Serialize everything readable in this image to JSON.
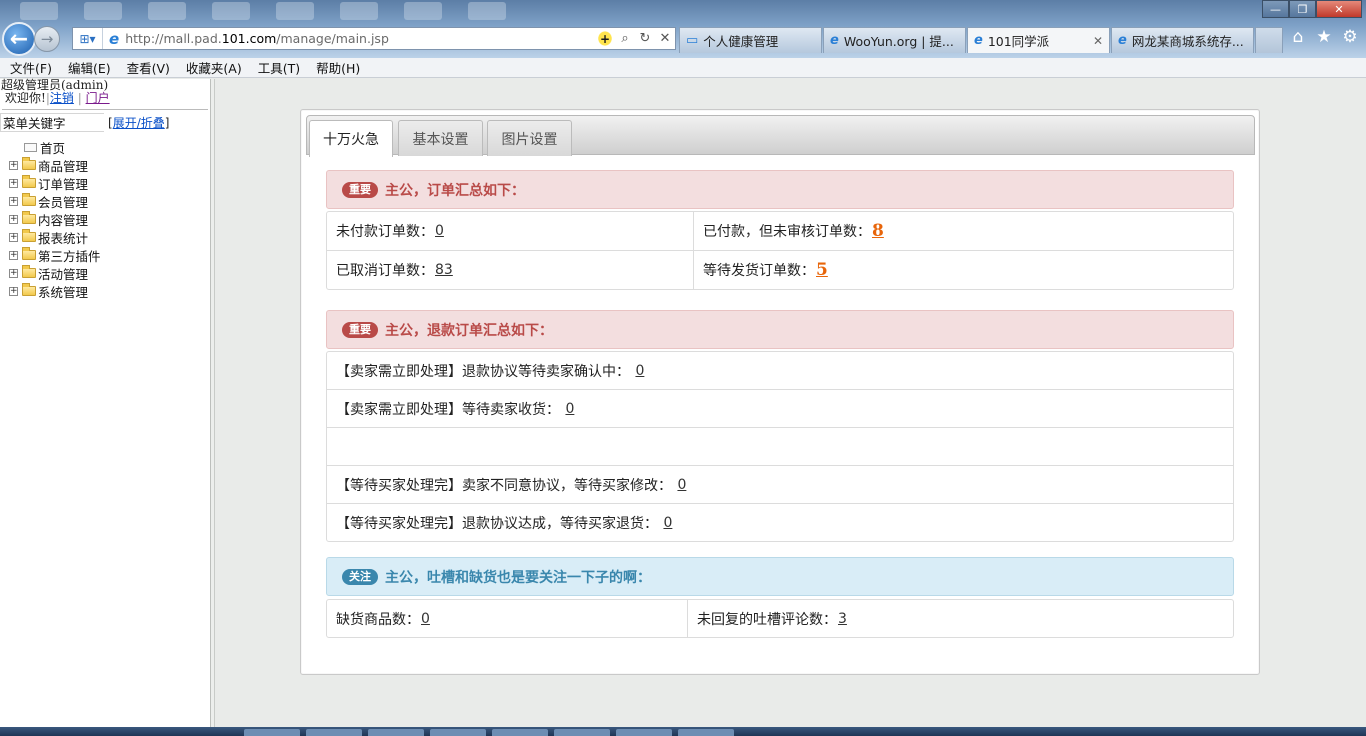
{
  "browser": {
    "url_prefix": "http://mall.pad.",
    "url_host": "101.com",
    "url_path": "/manage/main.jsp",
    "tabs": [
      {
        "label": "个人健康管理",
        "active": false
      },
      {
        "label": "WooYun.org | 提...",
        "active": false
      },
      {
        "label": "101同学派",
        "active": true
      },
      {
        "label": "网龙某商城系统存...",
        "active": false
      }
    ],
    "menu": [
      "文件(F)",
      "编辑(E)",
      "查看(V)",
      "收藏夹(A)",
      "工具(T)",
      "帮助(H)"
    ]
  },
  "sidebar": {
    "admin": "超级管理员(admin)",
    "welcome": "欢迎你!",
    "logout": "注销",
    "sep": "|",
    "portal": "门户",
    "search_value": "菜单关键字",
    "toggle_open": "[",
    "toggle_link": "展开/折叠",
    "toggle_close": "]",
    "home": "首页",
    "items": [
      "商品管理",
      "订单管理",
      "会员管理",
      "内容管理",
      "报表统计",
      "第三方插件",
      "活动管理",
      "系统管理"
    ]
  },
  "panel": {
    "tabs": [
      "十万火急",
      "基本设置",
      "图片设置"
    ],
    "orders": {
      "badge": "重要",
      "title": "主公，订单汇总如下：",
      "unpaid_label": "未付款订单数：",
      "unpaid_value": "0",
      "paid_unreviewed_label": "已付款，但未审核订单数：",
      "paid_unreviewed_value": "8",
      "cancelled_label": "已取消订单数：",
      "cancelled_value": "83",
      "awaiting_ship_label": "等待发货订单数：",
      "awaiting_ship_value": "5"
    },
    "refunds": {
      "badge": "重要",
      "title": "主公，退款订单汇总如下：",
      "row1_label": "【卖家需立即处理】退款协议等待卖家确认中：",
      "row1_value": "0",
      "row2_label": "【卖家需立即处理】等待卖家收货：",
      "row2_value": "0",
      "row4_label": "【等待买家处理完】卖家不同意协议，等待买家修改：",
      "row4_value": "0",
      "row5_label": "【等待买家处理完】退款协议达成，等待买家退货：",
      "row5_value": "0"
    },
    "attention": {
      "badge": "关注",
      "title": "主公，吐槽和缺货也是要关注一下子的啊：",
      "out_of_stock_label": "缺货商品数：",
      "out_of_stock_value": "0",
      "unreplied_label": "未回复的吐槽评论数：",
      "unreplied_value": "3"
    }
  }
}
